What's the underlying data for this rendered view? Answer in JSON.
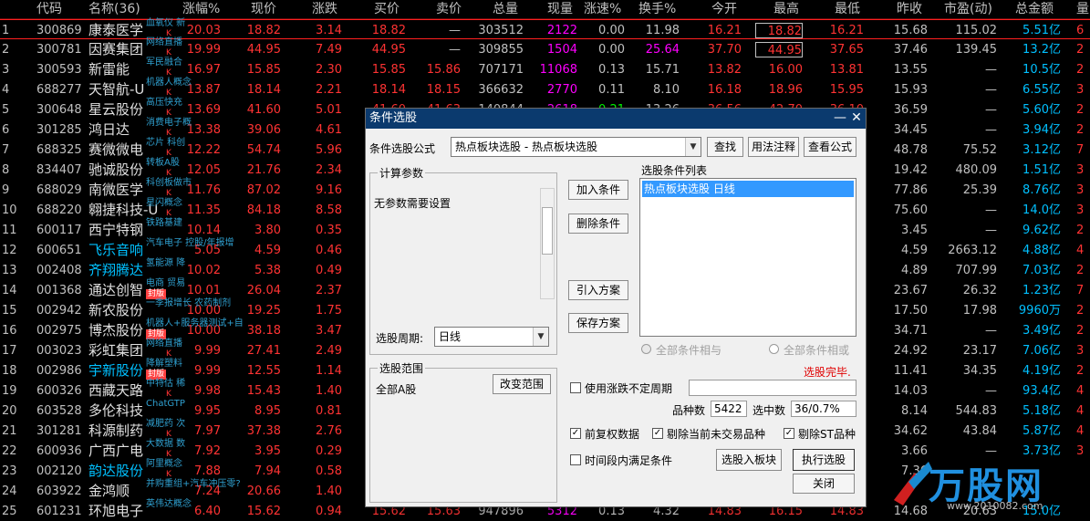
{
  "headers": {
    "code": "代码",
    "name": "名称(36)",
    "pct": "涨幅%",
    "price": "现价",
    "change": "涨跌",
    "bid": "买价",
    "ask": "卖价",
    "volume": "总量",
    "cur": "现量",
    "speed": "涨速%",
    "turnover": "换手%",
    "open": "今开",
    "high": "最高",
    "low": "最低",
    "prev": "昨收",
    "pe": "市盈(动)",
    "amount": "总金额",
    "vr": "量"
  },
  "rows": [
    {
      "i": "1",
      "code": "300869",
      "name": "康泰医学",
      "tag": "血氧仪 新",
      "k": "K",
      "pct": "20.03",
      "price": "18.82",
      "chg": "3.14",
      "bid": "18.82",
      "ask": "—",
      "vol": "303512",
      "cur": "2122",
      "spd": "0.00",
      "turn": "11.98",
      "open": "16.21",
      "high": "18.82",
      "low": "16.21",
      "prev": "15.68",
      "pe": "115.02",
      "amt": "5.51亿",
      "vr": "6"
    },
    {
      "i": "2",
      "code": "300781",
      "name": "因赛集团",
      "tag": "网络直播",
      "k": "K",
      "pct": "19.99",
      "price": "44.95",
      "chg": "7.49",
      "bid": "44.95",
      "ask": "—",
      "vol": "309855",
      "cur": "1504",
      "spd": "0.00",
      "turn": "25.64",
      "open": "37.70",
      "high": "44.95",
      "low": "37.65",
      "prev": "37.46",
      "pe": "139.45",
      "amt": "13.2亿",
      "vr": "2"
    },
    {
      "i": "3",
      "code": "300593",
      "name": "新雷能",
      "tag": "军民融合",
      "k": "K",
      "pct": "16.97",
      "price": "15.85",
      "chg": "2.30",
      "bid": "15.85",
      "ask": "15.86",
      "vol": "707171",
      "cur": "11068",
      "spd": "0.13",
      "turn": "15.71",
      "open": "13.82",
      "high": "16.00",
      "low": "13.81",
      "prev": "13.55",
      "pe": "—",
      "amt": "10.5亿",
      "vr": "2"
    },
    {
      "i": "4",
      "code": "688277",
      "name": "天智航-U",
      "tag": "机器人概念",
      "k": "K",
      "pct": "13.87",
      "price": "18.14",
      "chg": "2.21",
      "bid": "18.14",
      "ask": "18.15",
      "vol": "366632",
      "cur": "2770",
      "spd": "0.11",
      "turn": "8.10",
      "open": "16.18",
      "high": "18.96",
      "low": "15.95",
      "prev": "15.93",
      "pe": "—",
      "amt": "6.55亿",
      "vr": "3"
    },
    {
      "i": "5",
      "code": "300648",
      "name": "星云股份",
      "tag": "高压快充",
      "k": "K",
      "pct": "13.69",
      "price": "41.60",
      "chg": "5.01",
      "bid": "41.60",
      "ask": "41.63",
      "vol": "140844",
      "cur": "2618",
      "spd": "-0.21",
      "turn": "13.26",
      "open": "36.56",
      "high": "42.70",
      "low": "36.10",
      "prev": "36.59",
      "pe": "—",
      "amt": "5.60亿",
      "vr": "2"
    },
    {
      "i": "6",
      "code": "301285",
      "name": "鸿日达",
      "tag": "消费电子概",
      "k": "K",
      "pct": "13.38",
      "price": "39.06",
      "chg": "4.61",
      "bid": "",
      "ask": "",
      "vol": "",
      "cur": "",
      "spd": "",
      "turn": "",
      "open": "",
      "high": "",
      "low": "",
      "prev": "34.45",
      "pe": "—",
      "amt": "3.94亿",
      "vr": "2"
    },
    {
      "i": "7",
      "code": "688325",
      "name": "赛微微电",
      "tag": "芯片 科创",
      "k": "K",
      "pct": "12.22",
      "price": "54.74",
      "chg": "5.96",
      "bid": "",
      "ask": "",
      "vol": "",
      "cur": "",
      "spd": "",
      "turn": "",
      "open": "",
      "high": "",
      "low": "",
      "prev": "48.78",
      "pe": "75.52",
      "amt": "3.12亿",
      "vr": "7"
    },
    {
      "i": "8",
      "code": "834407",
      "name": "驰诚股份",
      "tag": "转板A股",
      "k": "K",
      "pct": "12.05",
      "price": "21.76",
      "chg": "2.34",
      "bid": "",
      "ask": "",
      "vol": "",
      "cur": "",
      "spd": "",
      "turn": "",
      "open": "",
      "high": "",
      "low": "",
      "prev": "19.42",
      "pe": "480.09",
      "amt": "1.51亿",
      "vr": "3"
    },
    {
      "i": "9",
      "code": "688029",
      "name": "南微医学",
      "tag": "科创板做市",
      "k": "K",
      "pct": "11.76",
      "price": "87.02",
      "chg": "9.16",
      "bid": "",
      "ask": "",
      "vol": "",
      "cur": "",
      "spd": "",
      "turn": "",
      "open": "",
      "high": "",
      "low": "",
      "prev": "77.86",
      "pe": "25.39",
      "amt": "8.76亿",
      "vr": "3"
    },
    {
      "i": "10",
      "code": "688220",
      "name": "翱捷科技-U",
      "tag": "星闪概念",
      "k": "K",
      "pct": "11.35",
      "price": "84.18",
      "chg": "8.58",
      "bid": "",
      "ask": "",
      "vol": "",
      "cur": "",
      "spd": "",
      "turn": "",
      "open": "",
      "high": "",
      "low": "",
      "prev": "75.60",
      "pe": "—",
      "amt": "14.0亿",
      "vr": "3"
    },
    {
      "i": "11",
      "code": "600117",
      "name": "西宁特钢",
      "tag": "铁路基建",
      "k": "",
      "pct": "10.14",
      "price": "3.80",
      "chg": "0.35",
      "bid": "",
      "ask": "",
      "vol": "",
      "cur": "",
      "spd": "",
      "turn": "",
      "open": "",
      "high": "",
      "low": "",
      "prev": "3.45",
      "pe": "—",
      "amt": "9.62亿",
      "vr": "2"
    },
    {
      "i": "12",
      "code": "600651",
      "name": "飞乐音响",
      "tag": "汽车电子 控股/年报增",
      "k": "",
      "pct": "5.05",
      "price": "4.59",
      "chg": "0.46",
      "bid": "",
      "ask": "",
      "vol": "",
      "cur": "",
      "spd": "",
      "turn": "",
      "open": "",
      "high": "",
      "low": "",
      "prev": "4.59",
      "pe": "2663.12",
      "amt": "4.88亿",
      "vr": "4"
    },
    {
      "i": "13",
      "code": "002408",
      "name": "齐翔腾达",
      "tag": "氢能源 降",
      "k": "",
      "pct": "10.02",
      "price": "5.38",
      "chg": "0.49",
      "bid": "",
      "ask": "",
      "vol": "",
      "cur": "",
      "spd": "",
      "turn": "",
      "open": "",
      "high": "",
      "low": "",
      "prev": "4.89",
      "pe": "707.99",
      "amt": "7.03亿",
      "vr": "2"
    },
    {
      "i": "14",
      "code": "001368",
      "name": "通达创智",
      "tag": "电商 贸易",
      "k": "封版",
      "pct": "10.01",
      "price": "26.04",
      "chg": "2.37",
      "bid": "",
      "ask": "",
      "vol": "",
      "cur": "",
      "spd": "",
      "turn": "",
      "open": "",
      "high": "",
      "low": "",
      "prev": "23.67",
      "pe": "26.32",
      "amt": "1.23亿",
      "vr": "7"
    },
    {
      "i": "15",
      "code": "002942",
      "name": "新农股份",
      "tag": "一季报增长 农药制剂",
      "k": "",
      "pct": "10.00",
      "price": "19.25",
      "chg": "1.75",
      "bid": "",
      "ask": "",
      "vol": "",
      "cur": "",
      "spd": "",
      "turn": "",
      "open": "",
      "high": "",
      "low": "",
      "prev": "17.50",
      "pe": "17.98",
      "amt": "9960万",
      "vr": "2"
    },
    {
      "i": "16",
      "code": "002975",
      "name": "博杰股份",
      "tag": "机器人+服务器测试+自",
      "k": "封版",
      "pct": "10.00",
      "price": "38.18",
      "chg": "3.47",
      "bid": "",
      "ask": "",
      "vol": "",
      "cur": "",
      "spd": "",
      "turn": "",
      "open": "",
      "high": "",
      "low": "",
      "prev": "34.71",
      "pe": "—",
      "amt": "3.49亿",
      "vr": "2"
    },
    {
      "i": "17",
      "code": "003023",
      "name": "彩虹集团",
      "tag": "网络直播",
      "k": "K",
      "pct": "9.99",
      "price": "27.41",
      "chg": "2.49",
      "bid": "",
      "ask": "",
      "vol": "",
      "cur": "",
      "spd": "",
      "turn": "",
      "open": "",
      "high": "",
      "low": "",
      "prev": "24.92",
      "pe": "23.17",
      "amt": "7.06亿",
      "vr": "3"
    },
    {
      "i": "18",
      "code": "002986",
      "name": "宇新股份",
      "tag": "降解塑料",
      "k": "封版",
      "pct": "9.99",
      "price": "12.55",
      "chg": "1.14",
      "bid": "",
      "ask": "",
      "vol": "",
      "cur": "",
      "spd": "",
      "turn": "",
      "open": "",
      "high": "",
      "low": "",
      "prev": "11.41",
      "pe": "34.35",
      "amt": "4.19亿",
      "vr": "2"
    },
    {
      "i": "19",
      "code": "600326",
      "name": "西藏天路",
      "tag": "中特估 稀",
      "k": "K",
      "pct": "9.98",
      "price": "15.43",
      "chg": "1.40",
      "bid": "",
      "ask": "",
      "vol": "",
      "cur": "",
      "spd": "",
      "turn": "",
      "open": "",
      "high": "",
      "low": "",
      "prev": "14.03",
      "pe": "—",
      "amt": "93.4亿",
      "vr": "4"
    },
    {
      "i": "20",
      "code": "603528",
      "name": "多伦科技",
      "tag": "ChatGTP",
      "k": "",
      "pct": "9.95",
      "price": "8.95",
      "chg": "0.81",
      "bid": "",
      "ask": "",
      "vol": "",
      "cur": "",
      "spd": "",
      "turn": "",
      "open": "",
      "high": "",
      "low": "",
      "prev": "8.14",
      "pe": "544.83",
      "amt": "5.18亿",
      "vr": "4"
    },
    {
      "i": "21",
      "code": "301281",
      "name": "科源制药",
      "tag": "减肥药 次",
      "k": "K",
      "pct": "7.97",
      "price": "37.38",
      "chg": "2.76",
      "bid": "",
      "ask": "",
      "vol": "",
      "cur": "",
      "spd": "",
      "turn": "",
      "open": "",
      "high": "",
      "low": "",
      "prev": "34.62",
      "pe": "43.84",
      "amt": "5.87亿",
      "vr": "4"
    },
    {
      "i": "22",
      "code": "600936",
      "name": "广西广电",
      "tag": "大数据 数",
      "k": "K",
      "pct": "7.92",
      "price": "3.95",
      "chg": "0.29",
      "bid": "",
      "ask": "",
      "vol": "",
      "cur": "",
      "spd": "",
      "turn": "",
      "open": "",
      "high": "",
      "low": "",
      "prev": "3.66",
      "pe": "—",
      "amt": "3.73亿",
      "vr": "3"
    },
    {
      "i": "23",
      "code": "002120",
      "name": "韵达股份",
      "tag": "阿里概念",
      "k": "K",
      "pct": "7.88",
      "price": "7.94",
      "chg": "0.58",
      "bid": "",
      "ask": "",
      "vol": "",
      "cur": "",
      "spd": "",
      "turn": "",
      "open": "",
      "high": "",
      "low": "",
      "prev": "7.36",
      "pe": "—",
      "amt": "",
      "vr": ""
    },
    {
      "i": "24",
      "code": "603922",
      "name": "金鸿顺",
      "tag": "并购重组+汽车冲压零?",
      "k": "",
      "pct": "7.24",
      "price": "20.66",
      "chg": "1.40",
      "bid": "",
      "ask": "",
      "vol": "",
      "cur": "",
      "spd": "",
      "turn": "",
      "open": "",
      "high": "",
      "low": "",
      "prev": "",
      "pe": "",
      "amt": "",
      "vr": ""
    },
    {
      "i": "25",
      "code": "601231",
      "name": "环旭电子",
      "tag": "英伟达概念",
      "k": "",
      "pct": "6.40",
      "price": "15.62",
      "chg": "0.94",
      "bid": "15.62",
      "ask": "15.63",
      "vol": "947896",
      "cur": "5312",
      "spd": "0.13",
      "turn": "4.32",
      "open": "14.83",
      "high": "16.15",
      "low": "14.83",
      "prev": "14.68",
      "pe": "20.63",
      "amt": "15.0亿",
      "vr": ""
    }
  ],
  "dialog": {
    "title": "条件选股",
    "formula_label": "条件选股公式",
    "formula_value": "热点板块选股  -  热点板块选股",
    "btn_find": "查找",
    "btn_usage": "用法注释",
    "btn_view": "查看公式",
    "params_group": "计算参数",
    "params_text": "无参数需要设置",
    "btn_add": "加入条件",
    "btn_delete": "删除条件",
    "btn_import": "引入方案",
    "btn_save": "保存方案",
    "list_title": "选股条件列表",
    "list_items": [
      "热点板块选股  日线"
    ],
    "period_label": "选股周期:",
    "period_value": "日线",
    "radio_and": "全部条件相与",
    "radio_or": "全部条件相或",
    "scope_group": "选股范围",
    "scope_value": "全部A股",
    "btn_change_scope": "改变范围",
    "status": "选股完毕.",
    "chk_uncertain": "使用涨跌不定周期",
    "count_label": "品种数",
    "count_value": "5422",
    "selected_label": "选中数",
    "selected_value": "36/0.7%",
    "chk_adjust": "前复权数据",
    "chk_exclude_untraded": "剔除当前未交易品种",
    "chk_exclude_st": "剔除ST品种",
    "chk_period": "时间段内满足条件",
    "btn_to_block": "选股入板块",
    "btn_execute": "执行选股",
    "btn_close": "关闭"
  },
  "logo": {
    "text": "万股网",
    "url": "www.2010082.com"
  },
  "colors": {
    "up": "#ff3333",
    "down": "#00ff00",
    "header": "#c0c0c0",
    "dialog_title": "#0b3a6e",
    "selected": "#3399ff"
  }
}
